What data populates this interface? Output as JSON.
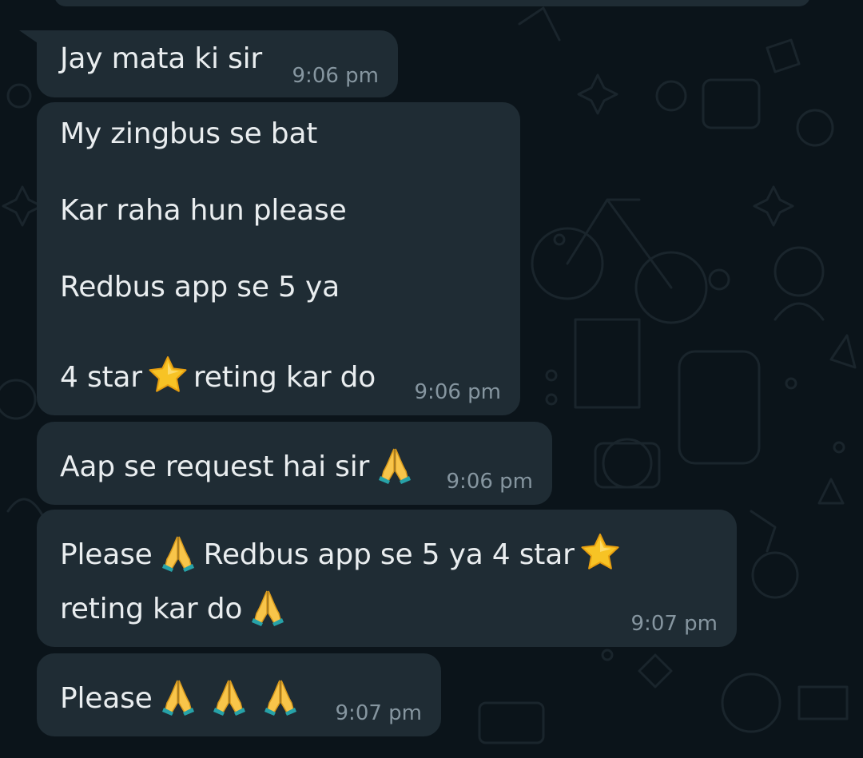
{
  "chat": {
    "messages": [
      {
        "lines": [
          "Jay mata ki sir"
        ],
        "time": "9:06 pm"
      },
      {
        "lines": [
          "My zingbus se bat",
          "Kar raha hun please",
          "Redbus app se 5 ya",
          "4 star",
          "reting kar do"
        ],
        "time": "9:06 pm"
      },
      {
        "lines": [
          "Aap se request hai sir"
        ],
        "time": "9:06 pm"
      },
      {
        "lines": [
          "Please",
          "Redbus app se 5 ya 4 star",
          "reting kar do"
        ],
        "time": "9:07 pm"
      },
      {
        "lines": [
          "Please"
        ],
        "time": "9:07 pm"
      }
    ]
  },
  "icons": {
    "star": "star-emoji",
    "pray": "folded-hands-emoji"
  },
  "colors": {
    "background": "#0b141a",
    "bubble": "#1f2c34",
    "text": "#e9edef",
    "timestamp": "#8696a0"
  }
}
